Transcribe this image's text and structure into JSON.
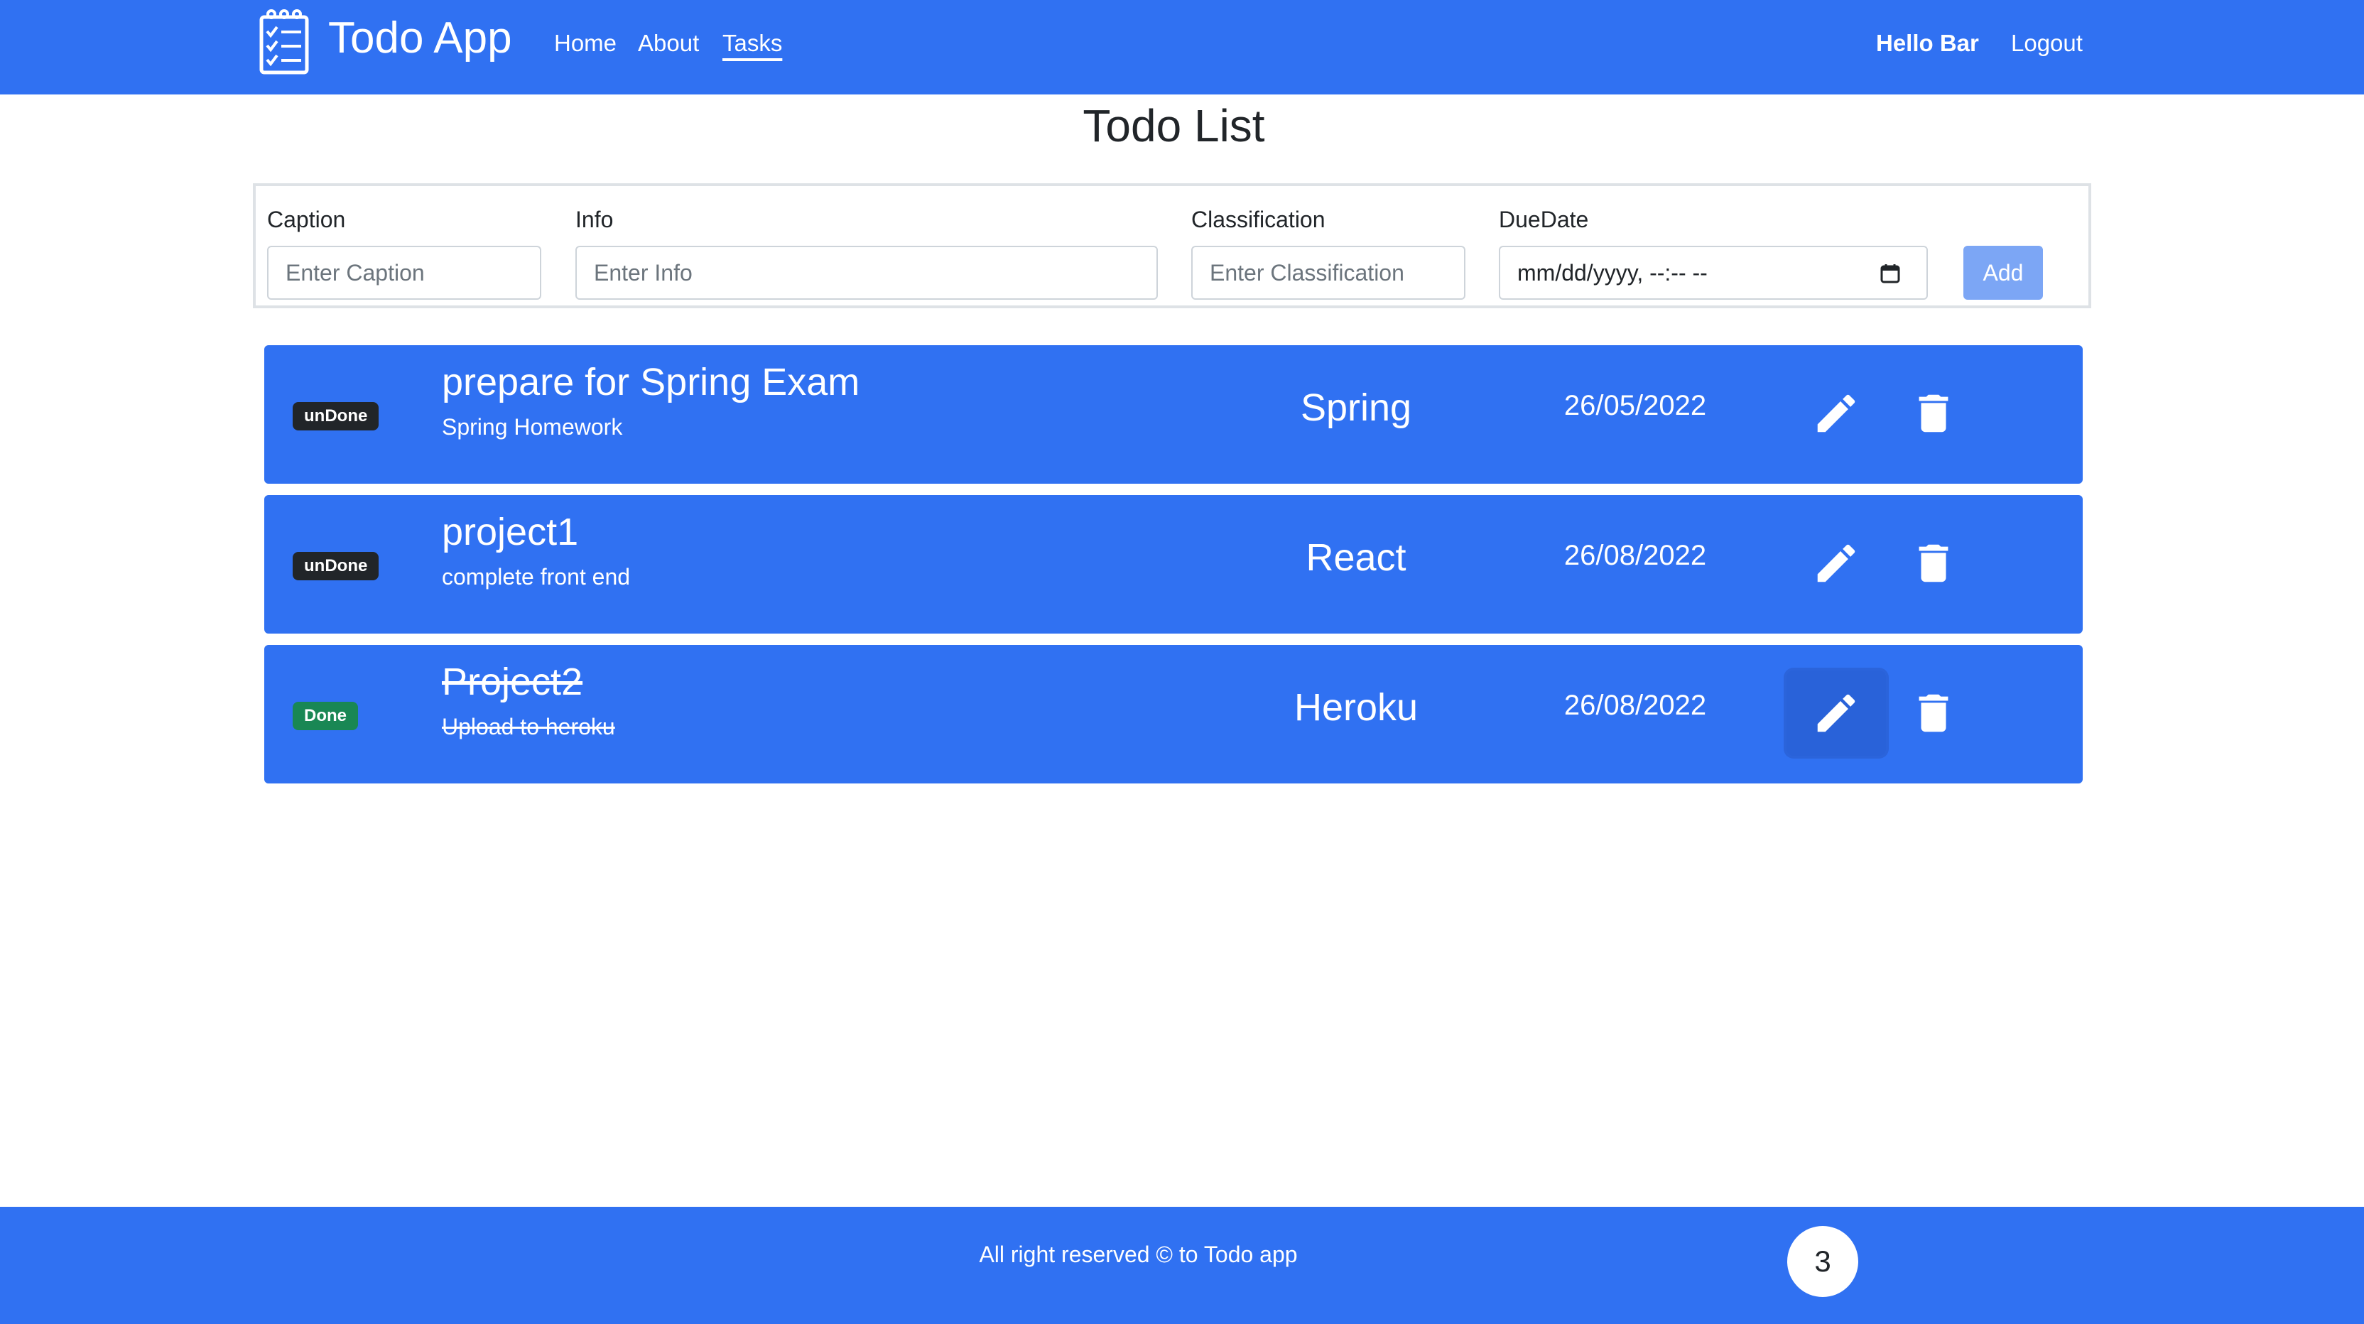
{
  "navbar": {
    "brand": "Todo App",
    "links": [
      "Home",
      "About",
      "Tasks"
    ],
    "active_link": "Tasks",
    "greeting": "Hello Bar",
    "logout": "Logout"
  },
  "page": {
    "title": "Todo List"
  },
  "form": {
    "caption": {
      "label": "Caption",
      "placeholder": "Enter Caption",
      "value": ""
    },
    "info": {
      "label": "Info",
      "placeholder": "Enter Info",
      "value": ""
    },
    "classification": {
      "label": "Classification",
      "placeholder": "Enter Classification",
      "value": ""
    },
    "due_date": {
      "label": "DueDate",
      "display": "mm/dd/yyyy, --:-- --"
    },
    "add_label": "Add"
  },
  "todos": [
    {
      "status": "unDone",
      "caption": "prepare for Spring Exam",
      "info": "Spring Homework",
      "classification": "Spring",
      "due_date": "26/05/2022",
      "done": false
    },
    {
      "status": "unDone",
      "caption": "project1",
      "info": "complete front end",
      "classification": "React",
      "due_date": "26/08/2022",
      "done": false
    },
    {
      "status": "Done",
      "caption": "Project2",
      "info": "Upload to heroku",
      "classification": "Heroku",
      "due_date": "26/08/2022",
      "done": true
    }
  ],
  "footer": {
    "text": "All right reserved © to Todo app",
    "count": "3"
  },
  "icons": {
    "brand": "clipboard-checklist-icon",
    "edit": "pencil-icon",
    "delete": "trash-icon",
    "calendar": "calendar-icon"
  },
  "colors": {
    "primary": "#3071f2",
    "badge_undone": "#212529",
    "badge_done": "#198754",
    "add_button": "#7ca6f5"
  }
}
